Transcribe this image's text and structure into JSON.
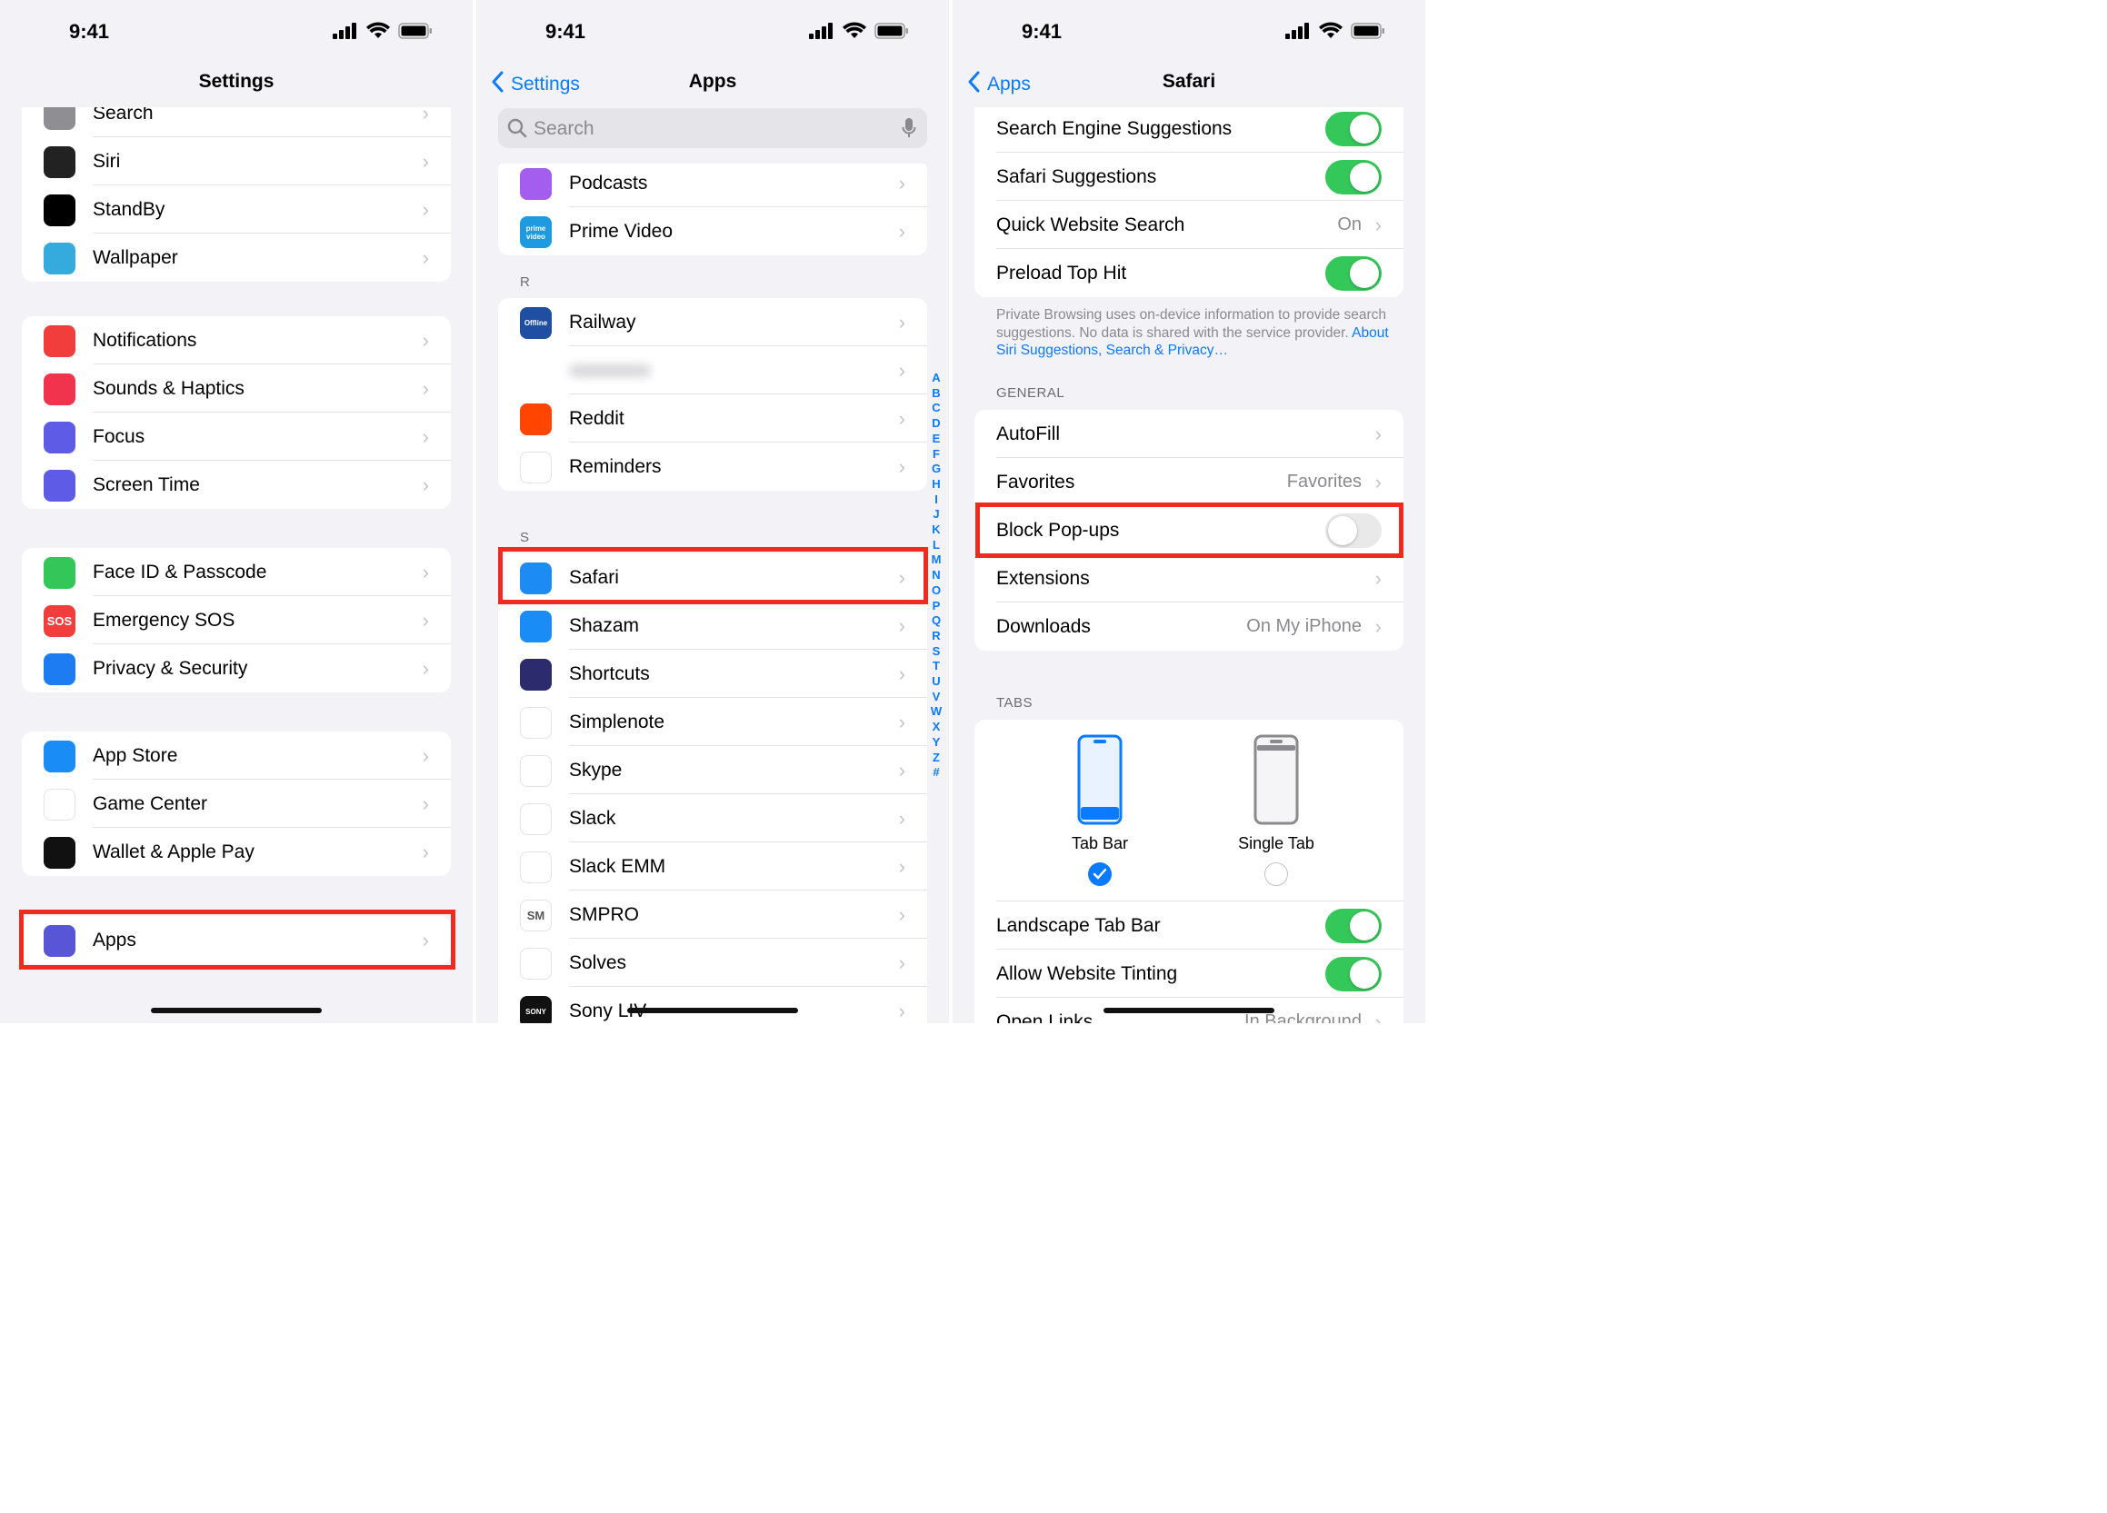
{
  "status": {
    "time": "9:41"
  },
  "panel1": {
    "title": "Settings",
    "groups": [
      [
        {
          "label": "Search",
          "icon": "search-icon",
          "color": "#8e8e93"
        },
        {
          "label": "Siri",
          "icon": "siri-icon",
          "color": "#222"
        },
        {
          "label": "StandBy",
          "icon": "standby-icon",
          "color": "#000"
        },
        {
          "label": "Wallpaper",
          "icon": "wallpaper-icon",
          "color": "#35aadc"
        }
      ],
      [
        {
          "label": "Notifications",
          "icon": "notifications-icon",
          "color": "#f23d3d"
        },
        {
          "label": "Sounds & Haptics",
          "icon": "sounds-icon",
          "color": "#f2334d"
        },
        {
          "label": "Focus",
          "icon": "focus-icon",
          "color": "#5e5ce6"
        },
        {
          "label": "Screen Time",
          "icon": "screen-time-icon",
          "color": "#5e5ce6"
        }
      ],
      [
        {
          "label": "Face ID & Passcode",
          "icon": "face-id-icon",
          "color": "#33c75a"
        },
        {
          "label": "Emergency SOS",
          "icon": "sos-icon",
          "color": "#f23d3d",
          "glyph": "SOS"
        },
        {
          "label": "Privacy & Security",
          "icon": "privacy-hand-icon",
          "color": "#1e7cf2"
        }
      ],
      [
        {
          "label": "App Store",
          "icon": "app-store-icon",
          "color": "#1a8cf5"
        },
        {
          "label": "Game Center",
          "icon": "game-center-icon",
          "color": "#fff"
        },
        {
          "label": "Wallet & Apple Pay",
          "icon": "wallet-icon",
          "color": "#111"
        }
      ],
      [
        {
          "label": "Apps",
          "icon": "apps-grid-icon",
          "color": "#5856d6"
        }
      ]
    ]
  },
  "panel2": {
    "back_label": "Settings",
    "title": "Apps",
    "search_placeholder": "Search",
    "group_top": [
      {
        "label": "Podcasts",
        "icon": "podcasts-icon",
        "color": "#a35ef0"
      },
      {
        "label": "Prime Video",
        "icon": "prime-video-icon",
        "color": "#1d9ae0",
        "glyph": "prime video"
      }
    ],
    "section_r": "R",
    "group_r": [
      {
        "label": "Railway",
        "icon": "railway-icon",
        "color": "#1f4ea3",
        "glyph": "Offline"
      },
      {
        "label": "",
        "icon": "blurred-app-icon",
        "color": "#fff"
      },
      {
        "label": "Reddit",
        "icon": "reddit-icon",
        "color": "#ff4500"
      },
      {
        "label": "Reminders",
        "icon": "reminders-icon",
        "color": "#fff"
      }
    ],
    "section_s": "S",
    "group_s": [
      {
        "label": "Safari",
        "icon": "safari-compass-icon",
        "color": "#1d8cf2"
      },
      {
        "label": "Shazam",
        "icon": "shazam-icon",
        "color": "#1a8cf5"
      },
      {
        "label": "Shortcuts",
        "icon": "shortcuts-icon",
        "color": "#2b2b6e"
      },
      {
        "label": "Simplenote",
        "icon": "simplenote-icon",
        "color": "#fff"
      },
      {
        "label": "Skype",
        "icon": "skype-icon",
        "color": "#fff"
      },
      {
        "label": "Slack",
        "icon": "slack-icon",
        "color": "#fff"
      },
      {
        "label": "Slack EMM",
        "icon": "slack-emm-icon",
        "color": "#fff"
      },
      {
        "label": "SMPRO",
        "icon": "smpro-icon",
        "color": "#fff",
        "glyph": "SM"
      },
      {
        "label": "Solves",
        "icon": "solves-calculator-icon",
        "color": "#fff"
      },
      {
        "label": "Sony LIV",
        "icon": "sony-liv-icon",
        "color": "#111",
        "glyph": "SONY"
      }
    ],
    "index_letters": [
      "A",
      "B",
      "C",
      "D",
      "E",
      "F",
      "G",
      "H",
      "I",
      "J",
      "K",
      "L",
      "M",
      "N",
      "O",
      "P",
      "Q",
      "R",
      "S",
      "T",
      "U",
      "V",
      "W",
      "X",
      "Y",
      "Z",
      "#"
    ]
  },
  "panel3": {
    "back_label": "Apps",
    "title": "Safari",
    "group_search": [
      {
        "label": "Search Engine Suggestions",
        "toggle": true
      },
      {
        "label": "Safari Suggestions",
        "toggle": true
      },
      {
        "label": "Quick Website Search",
        "value": "On"
      },
      {
        "label": "Preload Top Hit",
        "toggle": true
      }
    ],
    "footer_text": "Private Browsing uses on-device information to provide search suggestions. No data is shared with the service provider.",
    "footer_link": "About Siri Suggestions, Search & Privacy…",
    "general_header": "GENERAL",
    "group_general": [
      {
        "label": "AutoFill"
      },
      {
        "label": "Favorites",
        "value": "Favorites"
      },
      {
        "label": "Block Pop-ups",
        "toggle": false
      },
      {
        "label": "Extensions"
      },
      {
        "label": "Downloads",
        "value": "On My iPhone"
      }
    ],
    "tabs_header": "TABS",
    "tab_options": [
      {
        "label": "Tab Bar",
        "selected": true
      },
      {
        "label": "Single Tab",
        "selected": false
      }
    ],
    "group_tabs": [
      {
        "label": "Landscape Tab Bar",
        "toggle": true
      },
      {
        "label": "Allow Website Tinting",
        "toggle": true
      },
      {
        "label": "Open Links",
        "value": "In Background"
      }
    ]
  },
  "colors": {
    "accent": "#0a7aff",
    "highlight": "#ef2a1f",
    "toggle_on": "#34c759"
  }
}
